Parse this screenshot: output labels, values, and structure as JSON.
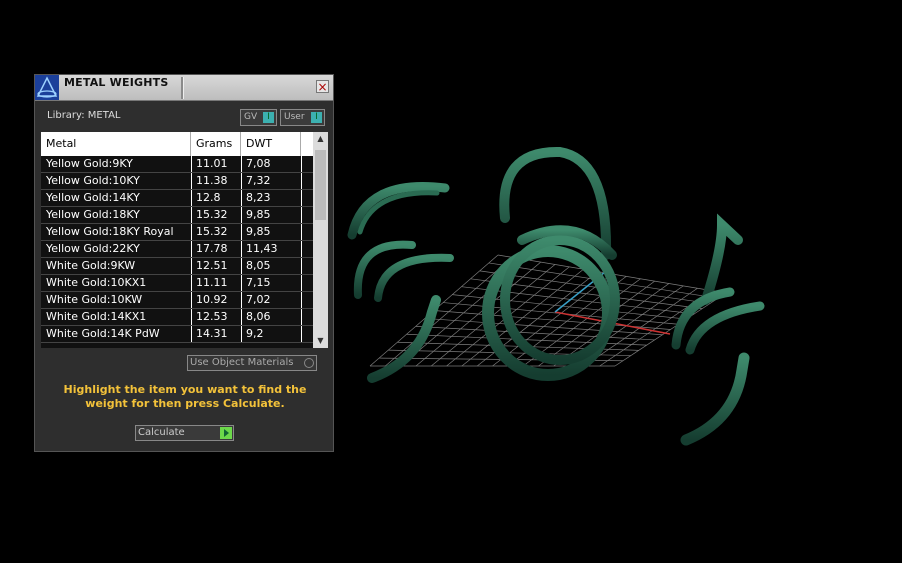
{
  "window": {
    "title": "METAL WEIGHTS",
    "close_label": "×",
    "library_label": "Library: METAL",
    "toggles": [
      {
        "label": "GV",
        "knob": "I"
      },
      {
        "label": "User",
        "knob": "I"
      }
    ]
  },
  "table": {
    "headers": [
      "Metal",
      "Grams",
      "DWT"
    ],
    "rows": [
      {
        "metal": "Yellow Gold:9KY",
        "grams": "11.01",
        "dwt": "7,08"
      },
      {
        "metal": "Yellow Gold:10KY",
        "grams": "11.38",
        "dwt": "7,32"
      },
      {
        "metal": "Yellow Gold:14KY",
        "grams": "12.8",
        "dwt": "8,23"
      },
      {
        "metal": "Yellow Gold:18KY",
        "grams": "15.32",
        "dwt": "9,85"
      },
      {
        "metal": "Yellow Gold:18KY Royal",
        "grams": "15.32",
        "dwt": "9,85"
      },
      {
        "metal": "Yellow Gold:22KY",
        "grams": "17.78",
        "dwt": "11,43"
      },
      {
        "metal": "White Gold:9KW",
        "grams": "12.51",
        "dwt": "8,05"
      },
      {
        "metal": "White Gold:10KX1",
        "grams": "11.11",
        "dwt": "7,15"
      },
      {
        "metal": "White Gold:10KW",
        "grams": "10.92",
        "dwt": "7,02"
      },
      {
        "metal": "White Gold:14KX1",
        "grams": "12.53",
        "dwt": "8,06"
      },
      {
        "metal": "White Gold:14K PdW",
        "grams": "14.31",
        "dwt": "9,2"
      }
    ],
    "scroll_up": "▲",
    "scroll_down": "▼"
  },
  "use_object_materials_label": "Use Object Materials",
  "instruction": "Highlight the item you want to find the weight for then press Calculate.",
  "calculate_label": "Calculate",
  "colors": {
    "ring": "#1f5d47",
    "grid": "#9a9a9a",
    "accent": "#f3c23a"
  }
}
